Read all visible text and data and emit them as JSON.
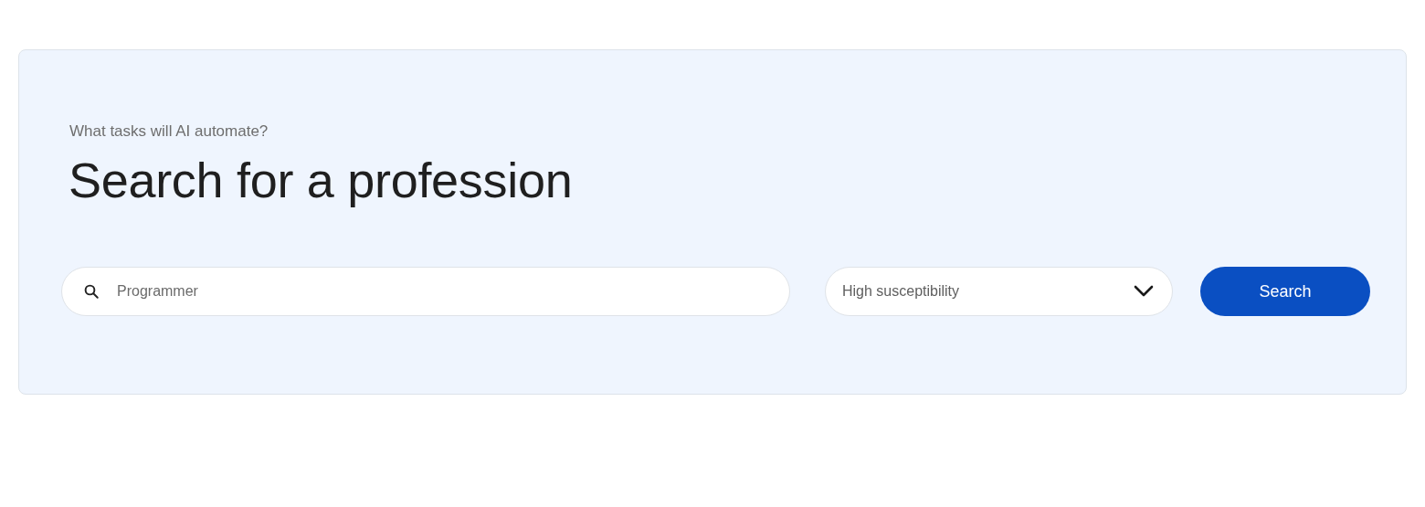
{
  "eyebrow": "What tasks will AI automate?",
  "heading": "Search for a profession",
  "search": {
    "placeholder": "Programmer"
  },
  "filter": {
    "value": "High susceptibility"
  },
  "button": "Search"
}
